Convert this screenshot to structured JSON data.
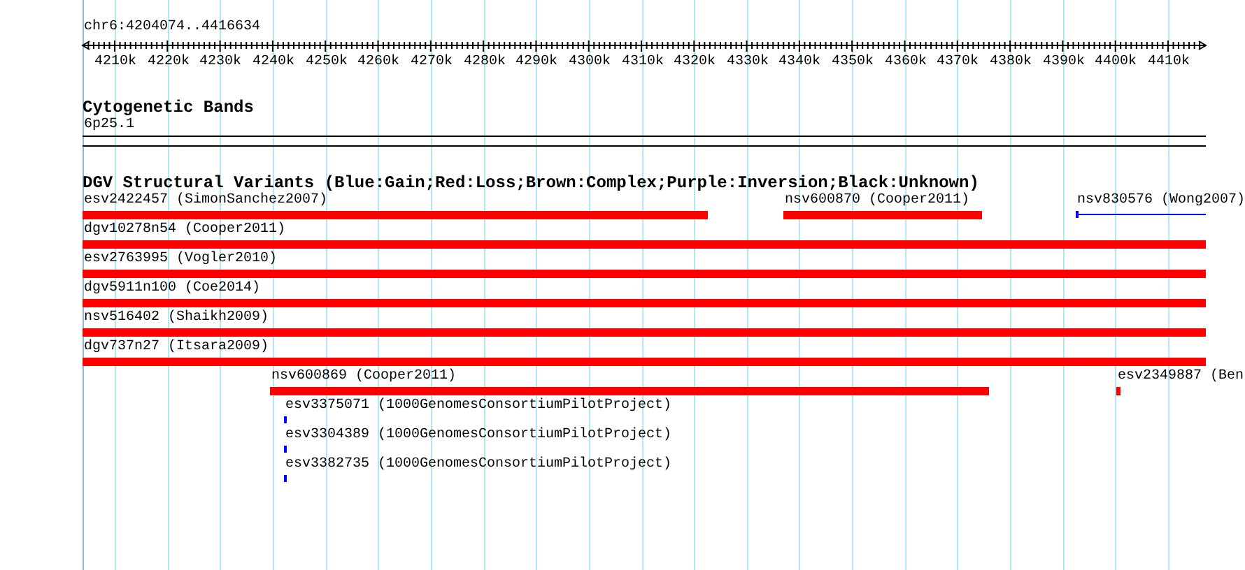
{
  "ruler": {
    "label": "chr6:4204074..4416634",
    "ticks": [
      "4210k",
      "4220k",
      "4230k",
      "4240k",
      "4250k",
      "4260k",
      "4270k",
      "4280k",
      "4290k",
      "4300k",
      "4310k",
      "4320k",
      "4330k",
      "4340k",
      "4350k",
      "4360k",
      "4370k",
      "4380k",
      "4390k",
      "4400k",
      "4410k"
    ]
  },
  "cytogenetic_bands": {
    "title": "Cytogenetic Bands",
    "band": "6p25.1"
  },
  "dgv_track": {
    "title": "DGV Structural Variants (Blue:Gain;Red:Loss;Brown:Complex;Purple:Inversion;Black:Unknown)",
    "rows": [
      {
        "features": [
          {
            "label": "esv2422457 (SimonSanchez2007)",
            "color": "#ff0000"
          },
          {
            "label": "nsv600870 (Cooper2011)",
            "color": "#ff0000"
          },
          {
            "label": "nsv830576 (Wong2007)",
            "color": "#0000ff"
          }
        ]
      },
      {
        "features": [
          {
            "label": "dgv10278n54 (Cooper2011)",
            "color": "#ff0000"
          }
        ]
      },
      {
        "features": [
          {
            "label": "esv2763995 (Vogler2010)",
            "color": "#ff0000"
          }
        ]
      },
      {
        "features": [
          {
            "label": "dgv5911n100 (Coe2014)",
            "color": "#ff0000"
          }
        ]
      },
      {
        "features": [
          {
            "label": "nsv516402 (Shaikh2009)",
            "color": "#ff0000"
          }
        ]
      },
      {
        "features": [
          {
            "label": "dgv737n27 (Itsara2009)",
            "color": "#ff0000"
          }
        ]
      },
      {
        "features": [
          {
            "label": "nsv600869 (Cooper2011)",
            "color": "#ff0000"
          },
          {
            "label": "esv2349887 (Ben",
            "color": "#ff0000"
          }
        ]
      },
      {
        "features": [
          {
            "label": "esv3375071 (1000GenomesConsortiumPilotProject)",
            "color": "#0000ff"
          }
        ]
      },
      {
        "features": [
          {
            "label": "esv3304389 (1000GenomesConsortiumPilotProject)",
            "color": "#0000ff"
          }
        ]
      },
      {
        "features": [
          {
            "label": "esv3382735 (1000GenomesConsortiumPilotProject)",
            "color": "#0000ff"
          }
        ]
      }
    ]
  }
}
